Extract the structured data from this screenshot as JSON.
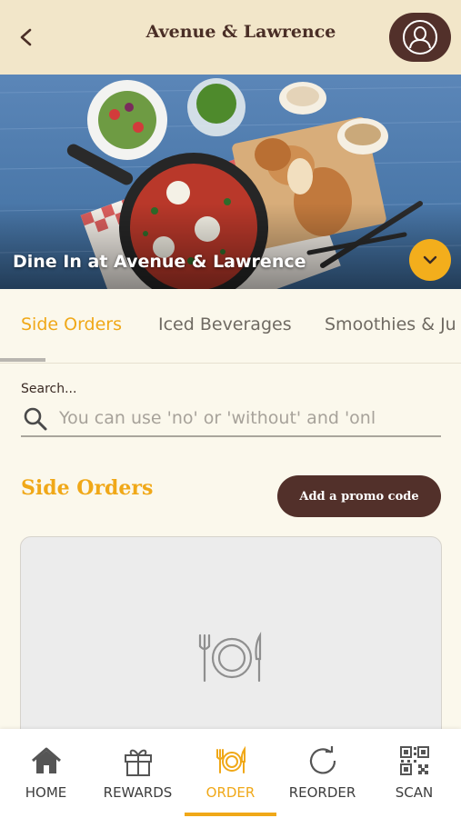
{
  "header": {
    "title": "Avenue & Lawrence",
    "back_icon": "chevron-left-icon",
    "profile_icon": "user-icon"
  },
  "hero": {
    "caption": "Dine In at Avenue & Lawrence",
    "expand_icon": "chevron-down-icon"
  },
  "tabs": [
    {
      "label": "Side Orders",
      "active": true
    },
    {
      "label": "Iced Beverages",
      "active": false
    },
    {
      "label": "Smoothies & Ju",
      "active": false
    }
  ],
  "search": {
    "label": "Search...",
    "placeholder": "You can use 'no' or 'without' and 'onl",
    "value": ""
  },
  "section": {
    "title": "Side Orders",
    "promo_label": "Add a promo code"
  },
  "nav": [
    {
      "label": "HOME",
      "icon": "home-icon",
      "active": false
    },
    {
      "label": "REWARDS",
      "icon": "gift-icon",
      "active": false
    },
    {
      "label": "ORDER",
      "icon": "plate-utensils-icon",
      "active": true
    },
    {
      "label": "REORDER",
      "icon": "refresh-icon",
      "active": false
    },
    {
      "label": "SCAN",
      "icon": "qr-code-icon",
      "active": false
    }
  ],
  "colors": {
    "accent": "#f0a818",
    "brand_dark": "#52302a",
    "header_bg": "#f2e6c9",
    "page_bg": "#fbf8ec"
  }
}
